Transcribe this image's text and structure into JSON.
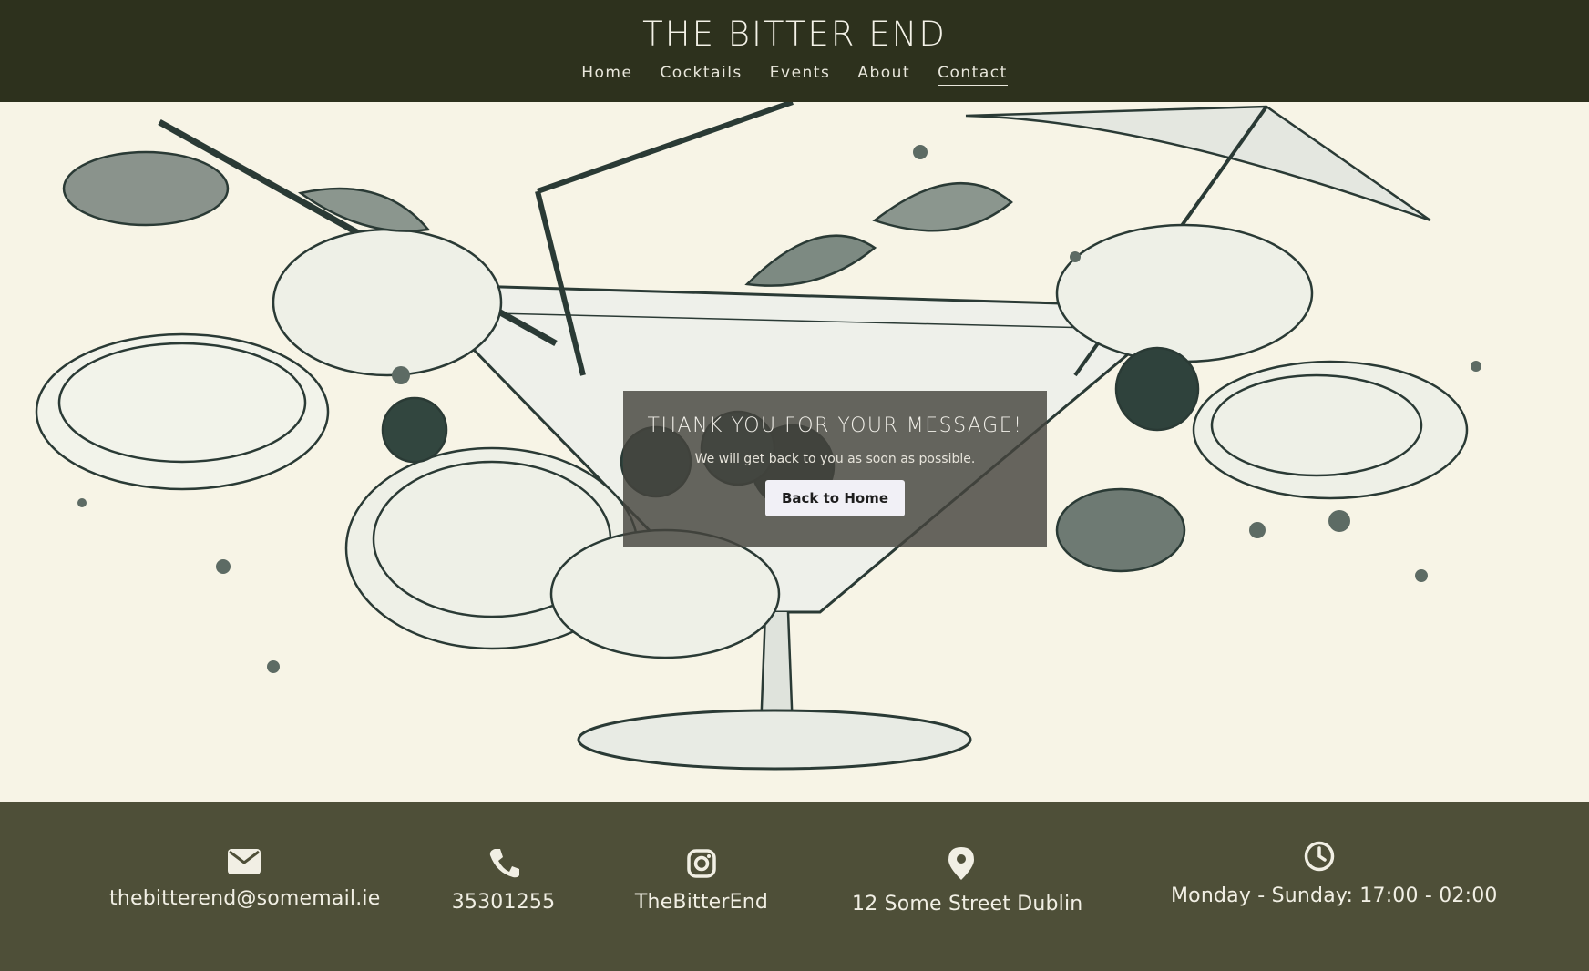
{
  "header": {
    "brand": "THE BITTER END",
    "nav": [
      {
        "label": "Home"
      },
      {
        "label": "Cocktails"
      },
      {
        "label": "Events"
      },
      {
        "label": "About"
      },
      {
        "label": "Contact",
        "active": true
      }
    ]
  },
  "hero": {
    "image_description_icon": "cocktail-illustration",
    "modal": {
      "title": "THANK YOU FOR YOUR MESSAGE!",
      "text": "We will get back to you as soon as possible.",
      "button_label": "Back to Home"
    }
  },
  "footer": {
    "email": {
      "icon": "envelope-icon",
      "label": "thebitterend@somemail.ie"
    },
    "phone": {
      "icon": "phone-icon",
      "label": "35301255"
    },
    "instagram": {
      "icon": "instagram-icon",
      "label": "TheBitterEnd"
    },
    "address": {
      "icon": "map-pin-icon",
      "label": "12 Some Street Dublin"
    },
    "hours": {
      "icon": "clock-icon",
      "label": "Monday - Sunday: 17:00 - 02:00"
    }
  },
  "colors": {
    "header_bg": "#2d311d",
    "footer_bg": "#4e4f38",
    "hero_bg": "#f7f4e6",
    "modal_bg": "#46443e"
  }
}
